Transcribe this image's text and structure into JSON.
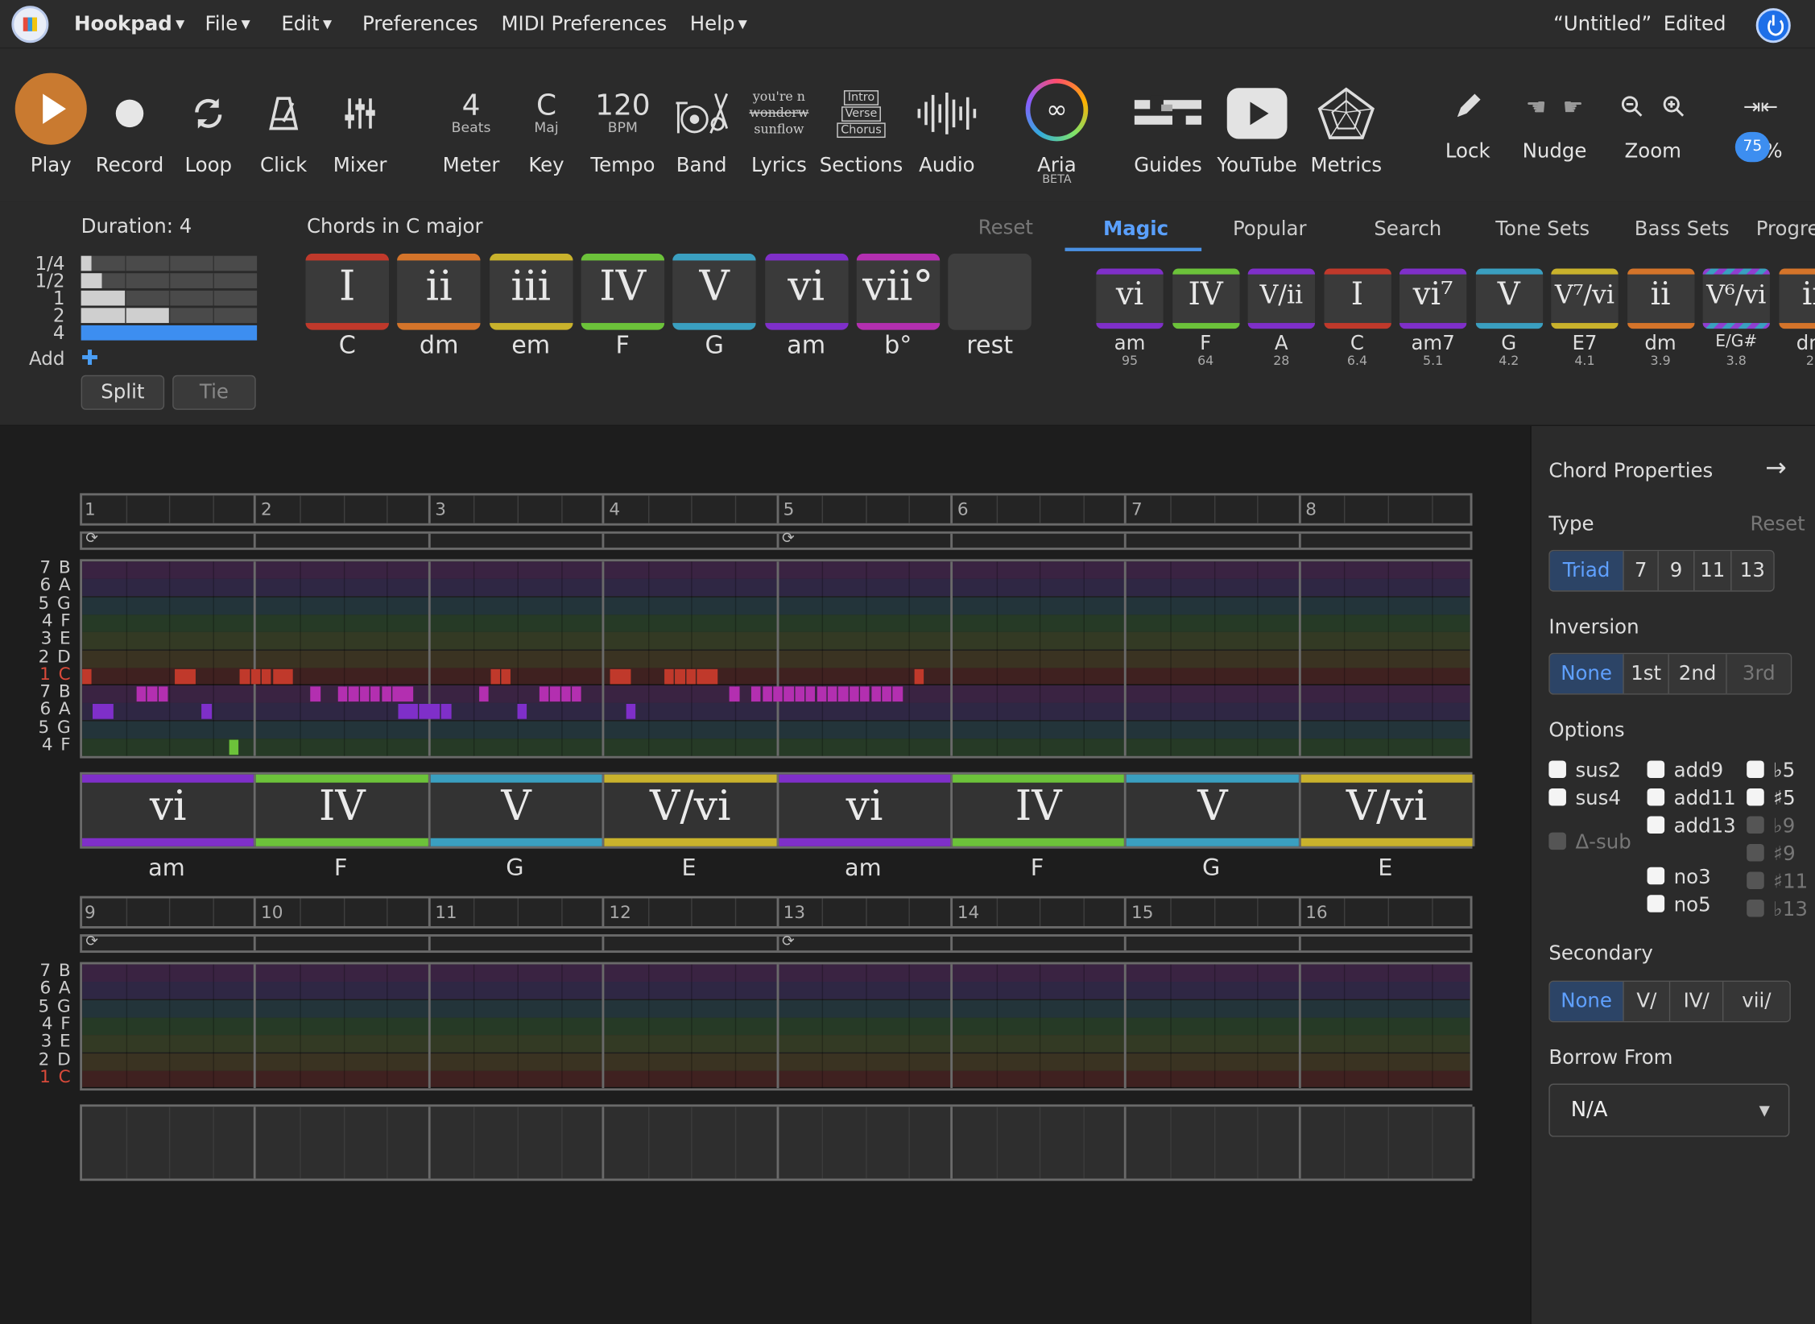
{
  "menubar": {
    "app": "Hookpad",
    "items": [
      "File",
      "Edit",
      "Preferences",
      "MIDI Preferences",
      "Help"
    ],
    "doc_title": "“Untitled”",
    "doc_status": "Edited"
  },
  "toolbar": {
    "play": "Play",
    "record": "Record",
    "loop": "Loop",
    "click": "Click",
    "mixer": "Mixer",
    "meter": {
      "value": "4",
      "unit": "Beats",
      "label": "Meter"
    },
    "key": {
      "value": "C",
      "unit": "Maj",
      "label": "Key"
    },
    "tempo": {
      "value": "120",
      "unit": "BPM",
      "label": "Tempo"
    },
    "band": "Band",
    "lyrics": {
      "label": "Lyrics",
      "line1": "you're n",
      "line2": "wonderw",
      "line3": "sunflow"
    },
    "sections": {
      "label": "Sections",
      "items": [
        "Intro",
        "Verse",
        "Chorus"
      ]
    },
    "audio": "Audio",
    "aria": "Aria",
    "aria_badge": "BETA",
    "guides": "Guides",
    "youtube": "YouTube",
    "metrics": "Metrics",
    "lock": "Lock",
    "nudge": "Nudge",
    "zoom": "Zoom",
    "zoom_level": "75%",
    "zoom_badge": "75"
  },
  "duration": {
    "title": "Duration: 4",
    "rows": [
      {
        "label": "1/4",
        "fill": 0.06
      },
      {
        "label": "1/2",
        "fill": 0.12
      },
      {
        "label": "1",
        "fill": 0.25
      },
      {
        "label": "2",
        "fill": 0.5
      },
      {
        "label": "4",
        "fill": 1.0
      }
    ],
    "add": "Add",
    "split": "Split",
    "tie": "Tie"
  },
  "palette": {
    "title": "Chords in C major",
    "reset": "Reset",
    "chords": [
      {
        "sym": "I",
        "name": "C",
        "color": "#c0392b"
      },
      {
        "sym": "ii",
        "name": "dm",
        "color": "#d4742a"
      },
      {
        "sym": "iii",
        "name": "em",
        "color": "#c9b22c"
      },
      {
        "sym": "IV",
        "name": "F",
        "color": "#6cc23a"
      },
      {
        "sym": "V",
        "name": "G",
        "color": "#3a9fc0"
      },
      {
        "sym": "vi",
        "name": "am",
        "color": "#7f2fc9"
      },
      {
        "sym": "vii°",
        "name": "b°",
        "color": "#b32fb0"
      },
      {
        "sym": "",
        "name": "rest",
        "color": "#3a3a3a"
      }
    ]
  },
  "tabs": [
    "Magic",
    "Popular",
    "Search",
    "Tone Sets",
    "Bass Sets",
    "Progre"
  ],
  "magic": [
    {
      "sym": "vi",
      "name": "am",
      "score": "95",
      "color": "#7f2fc9"
    },
    {
      "sym": "IV",
      "name": "F",
      "score": "64",
      "color": "#6cc23a"
    },
    {
      "sym": "V/ii",
      "name": "A",
      "score": "28",
      "color": "#7f2fc9"
    },
    {
      "sym": "I",
      "name": "C",
      "score": "6.4",
      "color": "#c0392b"
    },
    {
      "sym": "vi⁷",
      "name": "am7",
      "score": "5.1",
      "color": "#7f2fc9"
    },
    {
      "sym": "V",
      "name": "G",
      "score": "4.2",
      "color": "#3a9fc0"
    },
    {
      "sym": "V⁷/vi",
      "name": "E7",
      "score": "4.1",
      "color": "#c9b22c"
    },
    {
      "sym": "ii",
      "name": "dm",
      "score": "3.9",
      "color": "#d4742a"
    },
    {
      "sym": "V⁶/vi",
      "name": "E/G#",
      "score": "3.8",
      "color": "#8f3fd0"
    },
    {
      "sym": "ii",
      "name": "dm",
      "score": "2.",
      "color": "#d4742a"
    }
  ],
  "editor": {
    "measures1": [
      "1",
      "2",
      "3",
      "4",
      "5",
      "6",
      "7",
      "8"
    ],
    "measures2": [
      "9",
      "10",
      "11",
      "12",
      "13",
      "14",
      "15",
      "16"
    ],
    "lanes_top": [
      "7 B",
      "6 A",
      "5 G",
      "4 F",
      "3 E",
      "2 D",
      "1 C"
    ],
    "lanes_bottom": [
      "7 B",
      "6 A",
      "5 G",
      "4 F"
    ],
    "chords": [
      {
        "sym": "vi",
        "name": "am",
        "color": "#7f2fc9"
      },
      {
        "sym": "IV",
        "name": "F",
        "color": "#6cc23a"
      },
      {
        "sym": "V",
        "name": "G",
        "color": "#3a9fc0"
      },
      {
        "sym": "V/vi",
        "name": "E",
        "color": "#c9b22c"
      },
      {
        "sym": "vi",
        "name": "am",
        "color": "#7f2fc9"
      },
      {
        "sym": "IV",
        "name": "F",
        "color": "#6cc23a"
      },
      {
        "sym": "V",
        "name": "G",
        "color": "#3a9fc0"
      },
      {
        "sym": "V/vi",
        "name": "E",
        "color": "#c9b22c"
      }
    ]
  },
  "props": {
    "title": "Chord Properties",
    "type_label": "Type",
    "reset": "Reset",
    "types": [
      "Triad",
      "7",
      "9",
      "11",
      "13"
    ],
    "inversion_label": "Inversion",
    "inversions": [
      "None",
      "1st",
      "2nd",
      "3rd"
    ],
    "options_label": "Options",
    "opts_col1": [
      "sus2",
      "sus4"
    ],
    "opts_col1_dis": [
      "Δ-sub"
    ],
    "opts_col2": [
      "add9",
      "add11",
      "add13",
      "no3",
      "no5"
    ],
    "opts_col3": [
      "♭5",
      "♯5"
    ],
    "opts_col3_dis": [
      "♭9",
      "♯9",
      "♯11",
      "♭13"
    ],
    "secondary_label": "Secondary",
    "secondaries": [
      "None",
      "V/",
      "IV/",
      "vii/"
    ],
    "borrow_label": "Borrow From",
    "borrow_value": "N/A"
  }
}
